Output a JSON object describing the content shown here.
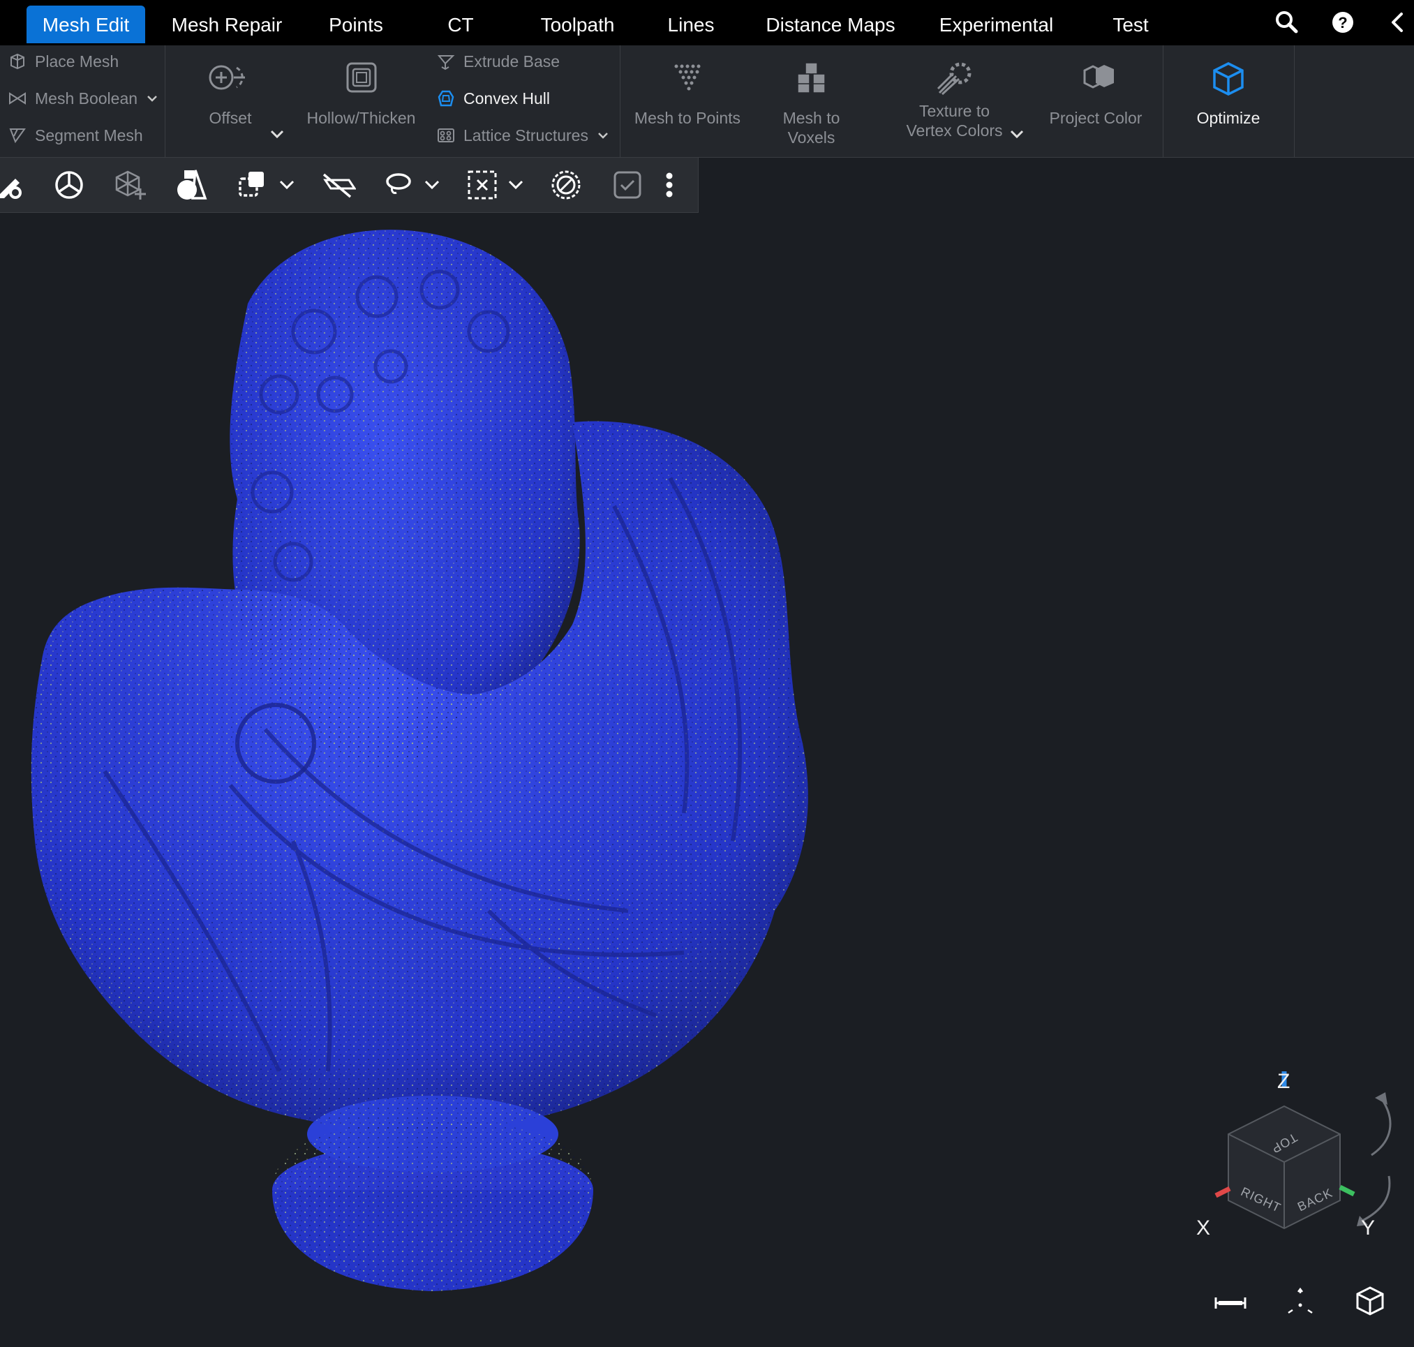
{
  "tabs": [
    {
      "label": "Mesh Edit",
      "active": true
    },
    {
      "label": "Mesh Repair"
    },
    {
      "label": "Points"
    },
    {
      "label": "CT"
    },
    {
      "label": "Toolpath"
    },
    {
      "label": "Lines"
    },
    {
      "label": "Distance Maps"
    },
    {
      "label": "Experimental"
    },
    {
      "label": "Test"
    }
  ],
  "top_icons": [
    "search-icon",
    "help-icon",
    "collapse-left-icon"
  ],
  "ribbon": {
    "group1": {
      "place_mesh": "Place Mesh",
      "mesh_boolean": "Mesh Boolean",
      "segment_mesh": "Segment Mesh"
    },
    "offset": "Offset",
    "hollow_thicken": "Hollow/Thicken",
    "extrude_base": "Extrude Base",
    "convex_hull": "Convex Hull",
    "lattice_structures": "Lattice Structures",
    "mesh_to_points": "Mesh to Points",
    "mesh_to_voxels": "Mesh to Voxels",
    "texture_to_vertex_colors_line1": "Texture to",
    "texture_to_vertex_colors_line2": "Vertex Colors",
    "project_color": "Project Color",
    "optimize": "Optimize"
  },
  "toolstrip_icons": [
    "edit-settings-icon",
    "mercedes-circle-icon",
    "add-node-icon",
    "shapes-icon",
    "duplicate-icon",
    "hide-icon",
    "lasso-icon",
    "box-select-icon",
    "no-select-icon",
    "checkbox-icon",
    "more-icon"
  ],
  "view_cube": {
    "axis_z": "Z",
    "axis_x": "X",
    "axis_y": "Y",
    "face_top": "TOP",
    "face_right": "RIGHT",
    "face_back": "BACK"
  },
  "colors": {
    "accent": "#0a72d6",
    "mesh_blue": "#2b40d8",
    "axis_x": "#e04848",
    "axis_y": "#3cc060",
    "axis_z": "#2e8ae8"
  }
}
